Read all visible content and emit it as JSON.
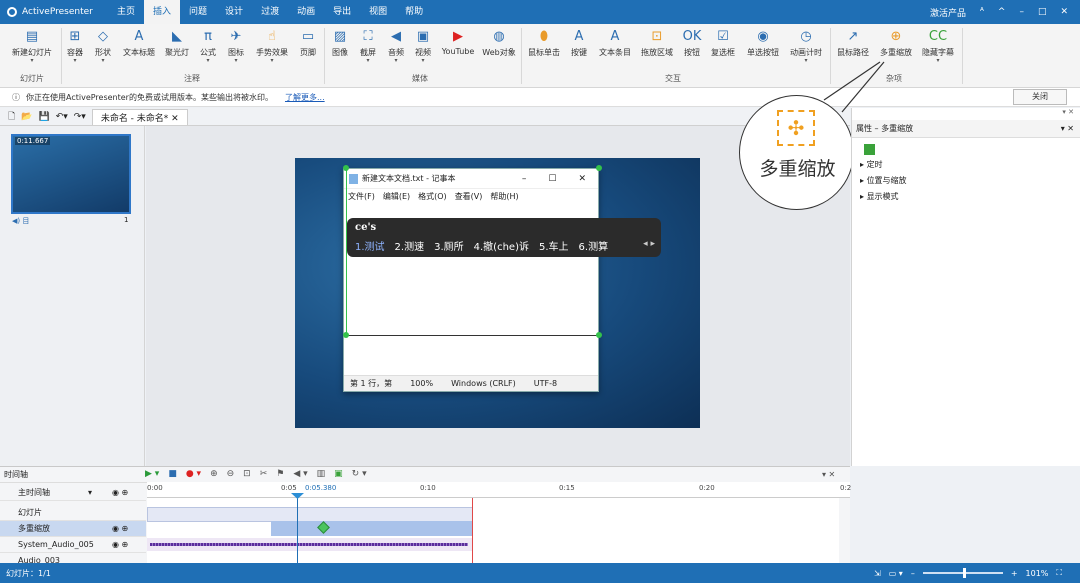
{
  "titlebar": {
    "app_name": "ActivePresenter",
    "tabs": [
      "主页",
      "插入",
      "问题",
      "设计",
      "过渡",
      "动画",
      "导出",
      "视图",
      "帮助"
    ],
    "active_tab": "插入",
    "activate": "激活产品",
    "win_controls": [
      "ᴬ",
      "^",
      "–",
      "□",
      "✕"
    ]
  },
  "ribbon": {
    "buttons": [
      {
        "label": "新建幻灯片",
        "icon": "new-slide-icon"
      },
      {
        "label": "容器",
        "icon": "container-icon"
      },
      {
        "label": "形状",
        "icon": "shape-icon"
      },
      {
        "label": "文本标题",
        "icon": "text-caption-icon"
      },
      {
        "label": "聚光灯",
        "icon": "spotlight-icon"
      },
      {
        "label": "公式",
        "icon": "equation-icon"
      },
      {
        "label": "图标",
        "icon": "icon-icon"
      },
      {
        "label": "手势效果",
        "icon": "gesture-icon"
      },
      {
        "label": "页脚",
        "icon": "footer-icon"
      },
      {
        "label": "图像",
        "icon": "image-icon"
      },
      {
        "label": "截屏",
        "icon": "screenshot-icon"
      },
      {
        "label": "音频",
        "icon": "audio-icon"
      },
      {
        "label": "视频",
        "icon": "video-icon"
      },
      {
        "label": "YouTube",
        "icon": "youtube-icon"
      },
      {
        "label": "Web对象",
        "icon": "web-object-icon"
      },
      {
        "label": "鼠标单击",
        "icon": "mouse-click-icon"
      },
      {
        "label": "按键",
        "icon": "keystroke-icon"
      },
      {
        "label": "文本条目",
        "icon": "text-entry-icon"
      },
      {
        "label": "拖放区域",
        "icon": "drop-area-icon"
      },
      {
        "label": "按钮",
        "icon": "button-icon"
      },
      {
        "label": "复选框",
        "icon": "checkbox-icon"
      },
      {
        "label": "单选按钮",
        "icon": "radio-icon"
      },
      {
        "label": "动画计时",
        "icon": "timer-icon"
      },
      {
        "label": "鼠标路径",
        "icon": "cursor-path-icon"
      },
      {
        "label": "多重缩放",
        "icon": "zoom-n-pan-icon"
      },
      {
        "label": "隐藏字幕",
        "icon": "closed-caption-icon"
      }
    ],
    "groups": [
      "幻灯片",
      "注释",
      "媒体",
      "交互",
      "杂项"
    ]
  },
  "infobar": {
    "message": "你正在使用ActivePresenter的免费或试用版本。某些输出将被水印。",
    "link": "了解更多...",
    "close": "关闭"
  },
  "document": {
    "tab": "未命名 - 未命名*",
    "thumb_time": "0:11.667",
    "thumb_index": "1"
  },
  "notepad": {
    "title": "新建文本文档.txt - 记事本",
    "menus": [
      "文件(F)",
      "编辑(E)",
      "格式(O)",
      "查看(V)",
      "帮助(H)"
    ],
    "status": [
      "第 1 行，第",
      "100%",
      "Windows (CRLF)",
      "UTF-8"
    ]
  },
  "ime": {
    "composition": "ce's",
    "candidates": [
      "1.测试",
      "2.测速",
      "3.厕所",
      "4.撤(che)诉",
      "5.车上",
      "6.测算"
    ],
    "nav": "◂ ▸"
  },
  "callout": {
    "label": "多重缩放"
  },
  "properties": {
    "header": "属性 – 多重缩放",
    "sections": [
      "定时",
      "位置与缩放",
      "显示模式"
    ]
  },
  "timeline": {
    "header": "时间轴",
    "main_label": "主时间轴",
    "ticks": [
      "0:00",
      "0:05",
      "0:05.380",
      "0:10",
      "0:15",
      "0:20",
      "0:2"
    ],
    "rows": [
      "幻灯片",
      "多重缩放",
      "System_Audio_005",
      "Audio_003"
    ]
  },
  "statusbar": {
    "slide": "幻灯片：1/1",
    "zoom": "101%"
  }
}
